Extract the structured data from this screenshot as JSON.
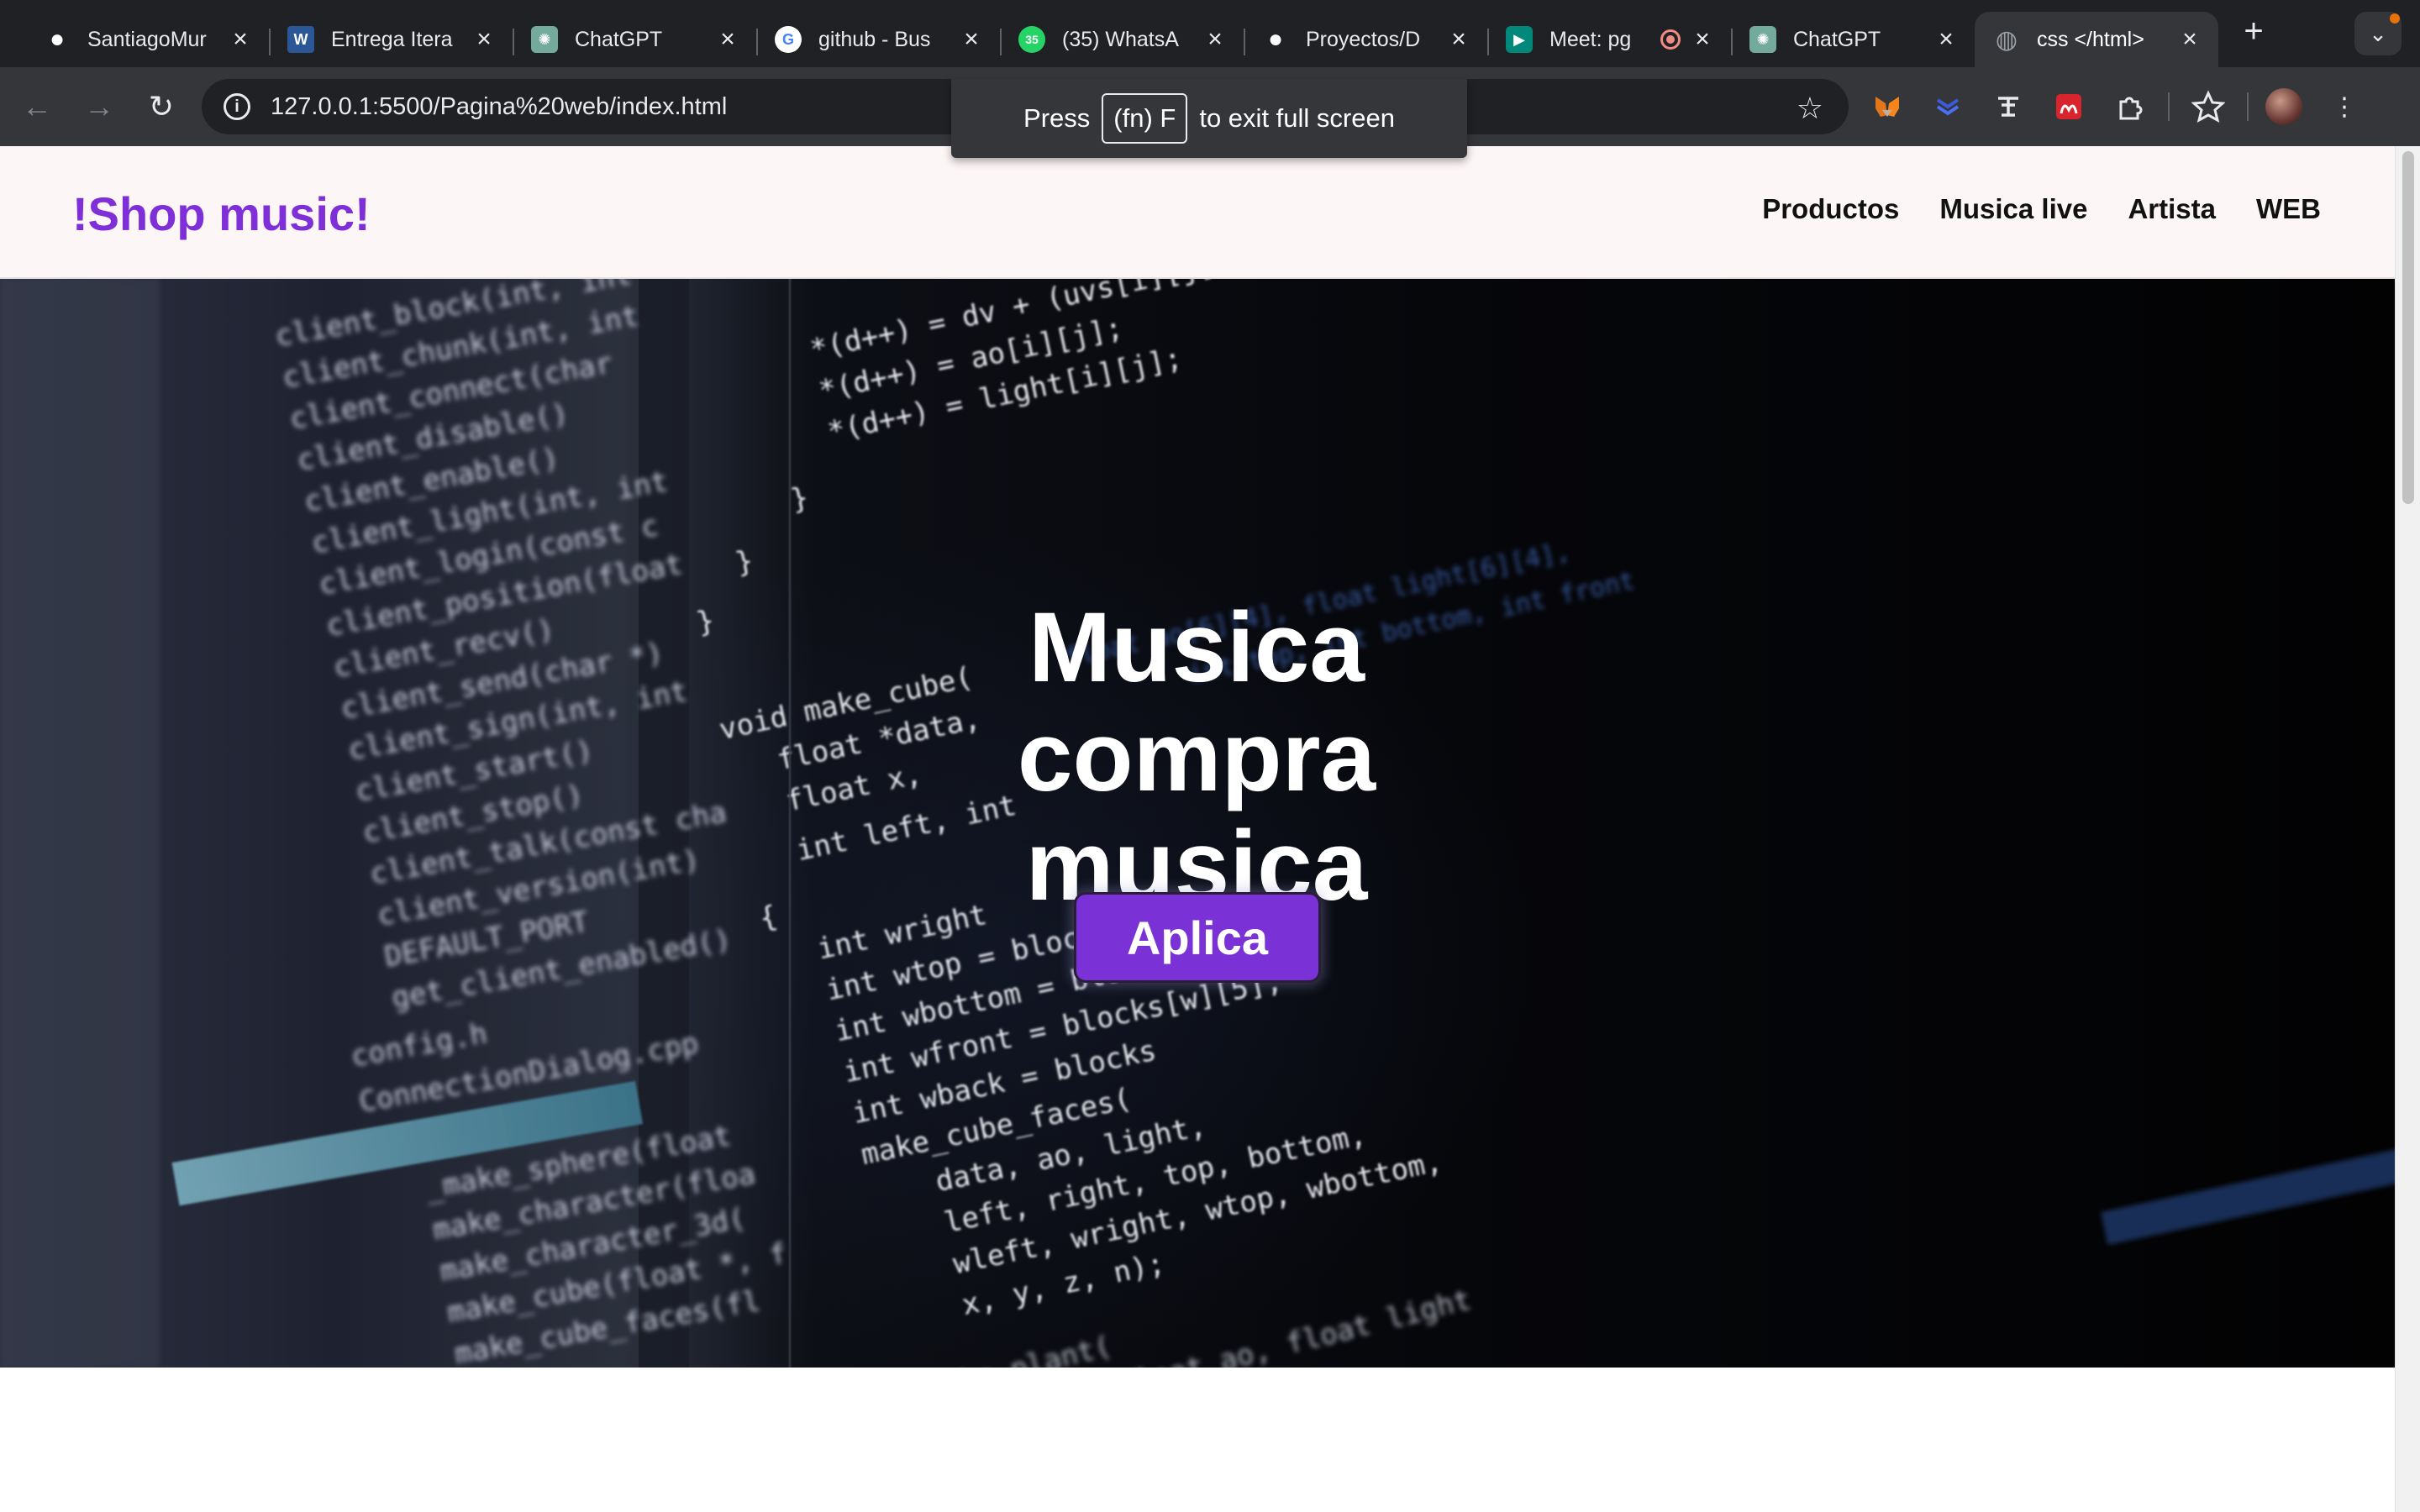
{
  "browser": {
    "tabs": [
      {
        "title": "SantiagoMur",
        "icon": "github-icon",
        "icon_color": "#ffffff",
        "active": false
      },
      {
        "title": "Entrega Itera",
        "icon": "word-icon",
        "icon_color": "#2b5797",
        "active": false
      },
      {
        "title": "ChatGPT",
        "icon": "chatgpt-icon",
        "icon_color": "#74aa9c",
        "active": false
      },
      {
        "title": "github - Bus",
        "icon": "google-icon",
        "icon_color": "#ffffff",
        "active": false
      },
      {
        "title": "(35) WhatsA",
        "icon": "whatsapp-icon",
        "icon_color": "#25d366",
        "badge": "35",
        "active": false
      },
      {
        "title": "Proyectos/D",
        "icon": "github-icon",
        "icon_color": "#ffffff",
        "active": false
      },
      {
        "title": "Meet: pg",
        "icon": "meet-icon",
        "icon_color": "#00897b",
        "active": false
      },
      {
        "title": "ChatGPT",
        "icon": "chatgpt-icon",
        "icon_color": "#74aa9c",
        "active": false
      },
      {
        "title": "css </html>",
        "icon": "globe-icon",
        "icon_color": "#9aa0a6",
        "active": true
      }
    ],
    "url": "127.0.0.1:5500/Pagina%20web/index.html",
    "fullscreen_toast": {
      "before": "Press",
      "key": "(fn) F",
      "after": "to exit full screen"
    }
  },
  "site": {
    "brand": "!Shop music!",
    "brand_color": "#7e2fd8",
    "nav": [
      "Productos",
      "Musica live",
      "Artista",
      "WEB"
    ],
    "hero": {
      "line1": "Musica",
      "line2": "compra musica",
      "button": "Aplica",
      "button_color": "#7a32d6"
    }
  }
}
